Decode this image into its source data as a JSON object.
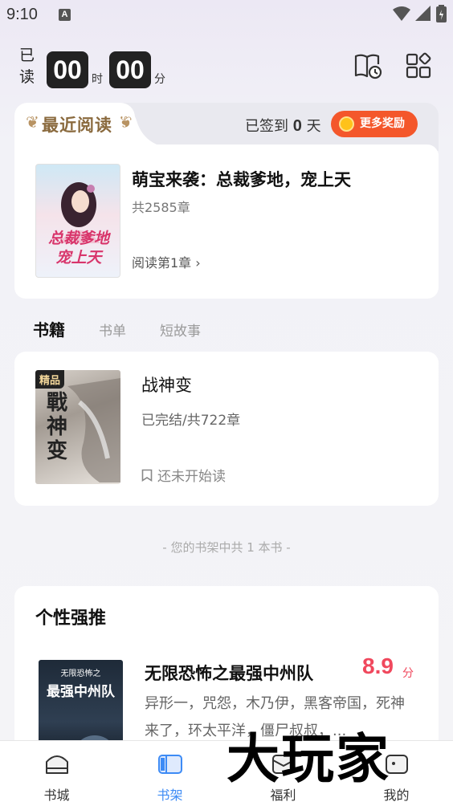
{
  "status_bar": {
    "time": "9:10",
    "notification_icon": "A"
  },
  "timer": {
    "label_1": "已",
    "label_2": "读",
    "hours": "00",
    "hours_unit": "时",
    "minutes": "00",
    "minutes_unit": "分"
  },
  "recent": {
    "title": "最近阅读",
    "signed_prefix": "已签到",
    "signed_days": "0",
    "signed_suffix": "天",
    "reward_label": "更多奖励",
    "book": {
      "title": "萌宝来袭：总裁爹地，宠上天",
      "chapters": "共2585章",
      "read_progress": "阅读第1章",
      "cover_line1": "总裁爹地",
      "cover_line2": "宠上天"
    }
  },
  "tabs": [
    "书籍",
    "书单",
    "短故事"
  ],
  "shelf": {
    "book": {
      "badge": "精品",
      "title": "战神变",
      "status": "已完结/共722章",
      "progress": "还未开始读",
      "cover_text": "戰神变"
    },
    "count_text": "- 您的书架中共 1 本书 -"
  },
  "recommend": {
    "heading": "个性强推",
    "book": {
      "title": "无限恐怖之最强中州队",
      "score": "8.9",
      "score_unit": "分",
      "desc": "异形一，咒怨，木乃伊，黑客帝国，死神来了，环太平洋，僵尸叔叔，...",
      "cover_line1": "无限恐怖之",
      "cover_line2": "最强中州队"
    }
  },
  "bottom_nav": [
    {
      "label": "书城",
      "icon": "bookstore-icon"
    },
    {
      "label": "书架",
      "icon": "bookshelf-icon"
    },
    {
      "label": "福利",
      "icon": "welfare-icon"
    },
    {
      "label": "我的",
      "icon": "profile-icon"
    }
  ],
  "watermark": "大玩家",
  "colors": {
    "accent_blue": "#3d8bf5",
    "reward_orange": "#f4572b",
    "score_red": "#f0485d",
    "gold": "#8a6a3e"
  }
}
